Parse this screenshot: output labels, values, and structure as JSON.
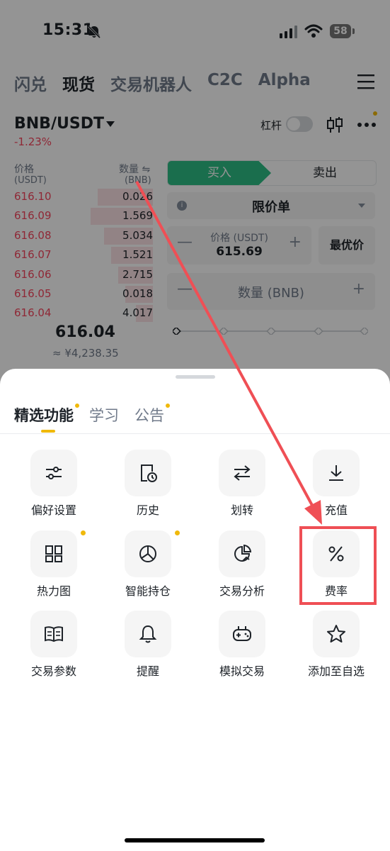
{
  "status_bar": {
    "time": "15:31",
    "battery": "58"
  },
  "top_tabs": [
    "闪兑",
    "现货",
    "交易机器人",
    "C2C",
    "Alpha"
  ],
  "pair": {
    "symbol": "BNB/USDT",
    "change": "-1.23%",
    "leverage_label": "杠杆"
  },
  "order_book": {
    "price_header": "价格",
    "price_unit": "(USDT)",
    "qty_header": "数量 ⇋",
    "qty_unit": "(BNB)",
    "asks": [
      {
        "price": "616.10",
        "qty": "0.026",
        "depth": 0.4
      },
      {
        "price": "616.09",
        "qty": "1.569",
        "depth": 0.45
      },
      {
        "price": "616.08",
        "qty": "5.034",
        "depth": 0.35
      },
      {
        "price": "616.07",
        "qty": "1.521",
        "depth": 0.3
      },
      {
        "price": "616.06",
        "qty": "2.715",
        "depth": 0.25
      },
      {
        "price": "616.05",
        "qty": "0.018",
        "depth": 0.2
      },
      {
        "price": "616.04",
        "qty": "4.017",
        "depth": 0.12
      }
    ],
    "last_price": "616.04",
    "last_fiat": "≈ ¥4,238.35"
  },
  "order_form": {
    "buy": "买入",
    "sell": "卖出",
    "order_type": "限价单",
    "price_label": "价格 (USDT)",
    "price_value": "615.69",
    "best_price": "最优价",
    "qty_label": "数量 (BNB)",
    "minus": "—",
    "plus": "+"
  },
  "sheet": {
    "tabs": [
      {
        "label": "精选功能",
        "active": true,
        "dot": true
      },
      {
        "label": "学习",
        "active": false,
        "dot": false
      },
      {
        "label": "公告",
        "active": false,
        "dot": true
      }
    ],
    "items": [
      {
        "label": "偏好设置",
        "icon": "sliders-icon",
        "dot": false
      },
      {
        "label": "历史",
        "icon": "history-icon",
        "dot": false
      },
      {
        "label": "划转",
        "icon": "transfer-icon",
        "dot": false
      },
      {
        "label": "充值",
        "icon": "deposit-icon",
        "dot": false
      },
      {
        "label": "热力图",
        "icon": "heatmap-icon",
        "dot": true
      },
      {
        "label": "智能持仓",
        "icon": "pie-chart-icon",
        "dot": true
      },
      {
        "label": "交易分析",
        "icon": "analysis-icon",
        "dot": false
      },
      {
        "label": "费率",
        "icon": "percent-icon",
        "dot": false
      },
      {
        "label": "交易参数",
        "icon": "book-icon",
        "dot": false
      },
      {
        "label": "提醒",
        "icon": "bell-icon",
        "dot": false
      },
      {
        "label": "模拟交易",
        "icon": "gamepad-icon",
        "dot": false
      },
      {
        "label": "添加至自选",
        "icon": "star-icon",
        "dot": false
      }
    ]
  },
  "colors": {
    "red": "#f6465d",
    "green": "#2ebd85",
    "yellow": "#f0b90b",
    "annotation": "#ef4f55"
  }
}
